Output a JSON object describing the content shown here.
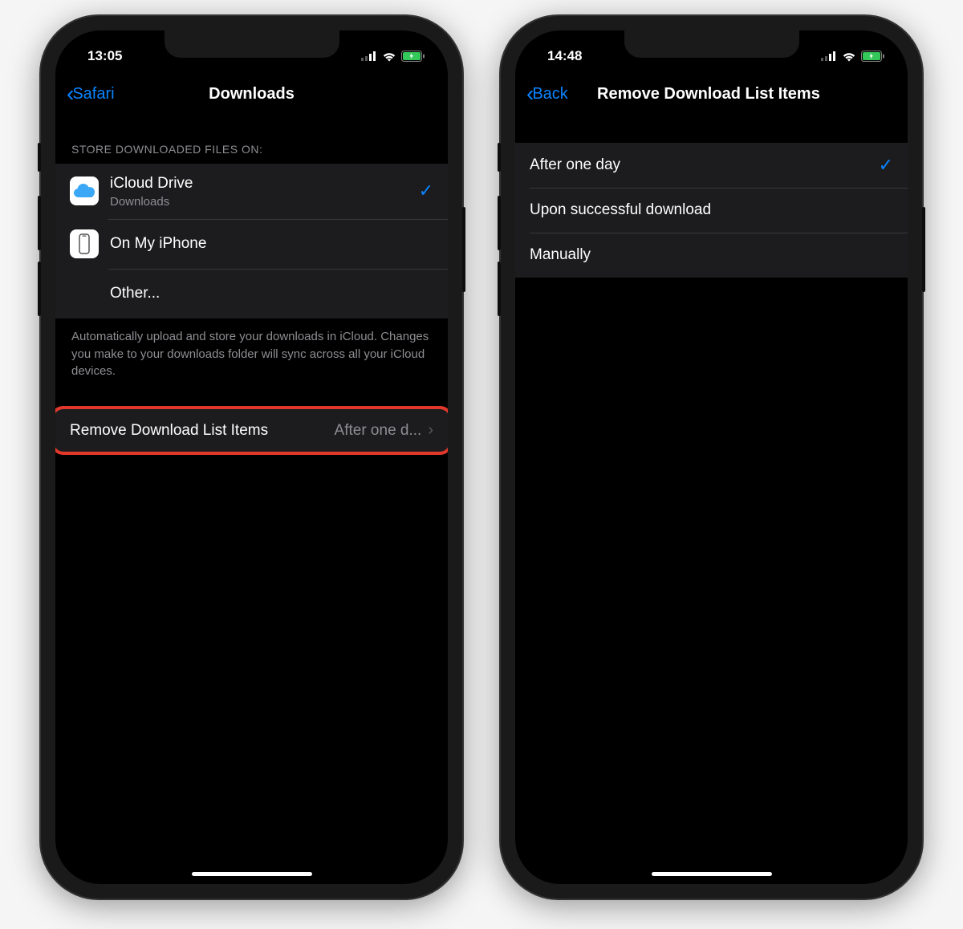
{
  "left": {
    "time": "13:05",
    "back": "Safari",
    "title": "Downloads",
    "section_header": "STORE DOWNLOADED FILES ON:",
    "options": [
      {
        "title": "iCloud Drive",
        "subtitle": "Downloads",
        "icon": "icloud",
        "selected": true
      },
      {
        "title": "On My iPhone",
        "subtitle": "",
        "icon": "iphone",
        "selected": false
      },
      {
        "title": "Other...",
        "subtitle": "",
        "icon": "",
        "selected": false
      }
    ],
    "footer": "Automatically upload and store your downloads in iCloud. Changes you make to your downloads folder will sync across all your iCloud devices.",
    "linkrow": {
      "label": "Remove Download List Items",
      "value": "After one d..."
    }
  },
  "right": {
    "time": "14:48",
    "back": "Back",
    "title": "Remove Download List Items",
    "options": [
      {
        "title": "After one day",
        "selected": true
      },
      {
        "title": "Upon successful download",
        "selected": false
      },
      {
        "title": "Manually",
        "selected": false
      }
    ]
  },
  "colors": {
    "accent": "#0a84ff",
    "highlight": "#e2382b",
    "cell": "#1c1c1e"
  }
}
